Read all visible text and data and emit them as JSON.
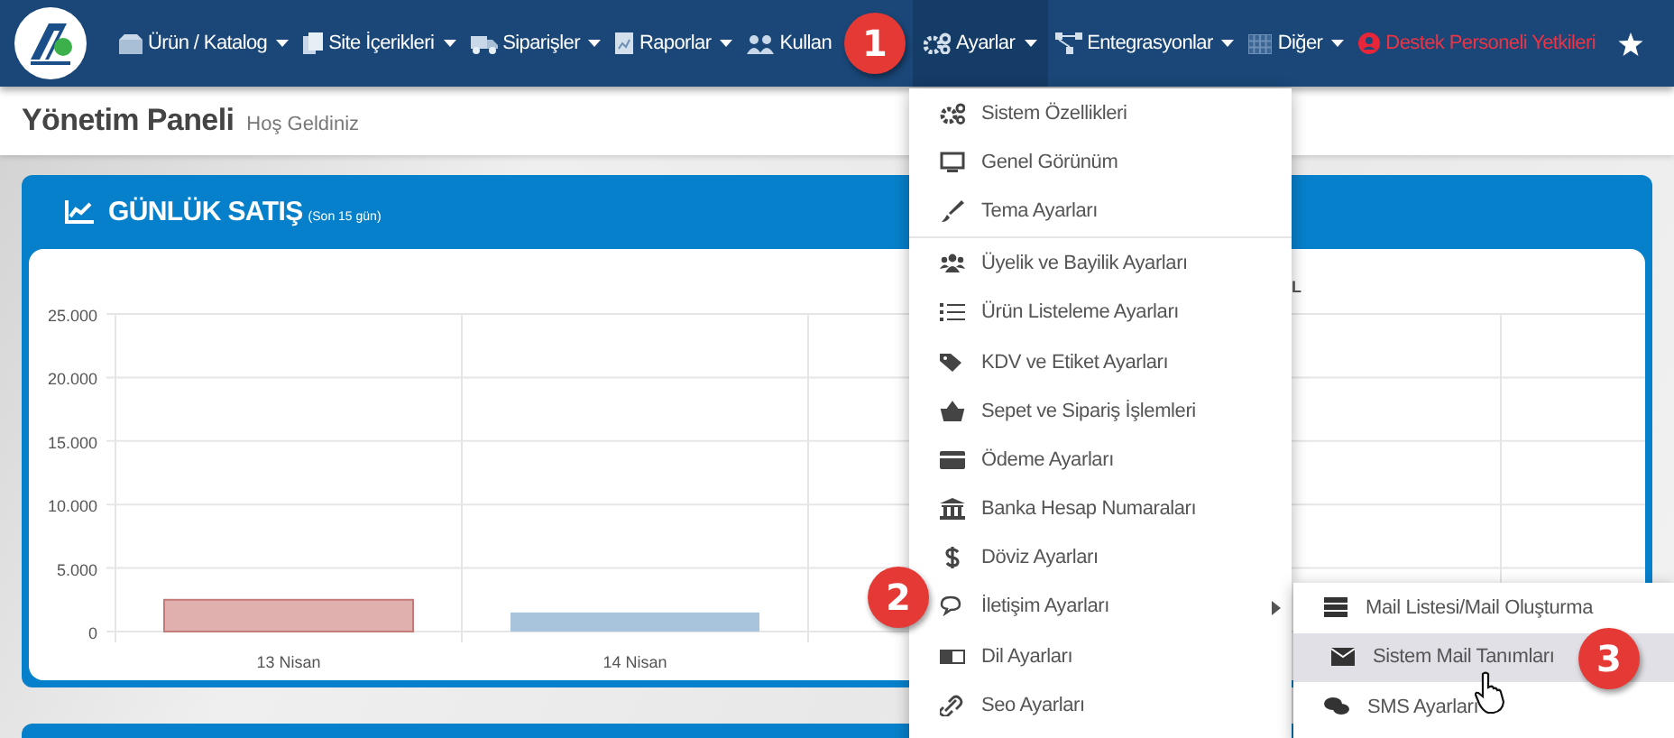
{
  "navbar": {
    "items": [
      {
        "label": "Ürün / Katalog",
        "caret": true,
        "selected": false,
        "kind": "link"
      },
      {
        "label": "Site İçerikleri",
        "caret": true,
        "selected": false,
        "kind": "link"
      },
      {
        "label": "Siparişler",
        "caret": true,
        "selected": false,
        "kind": "link"
      },
      {
        "label": "Raporlar",
        "caret": true,
        "selected": false,
        "kind": "link"
      },
      {
        "label": "Kullan",
        "caret": false,
        "selected": false,
        "kind": "link"
      },
      {
        "label": "Ayarlar",
        "caret": true,
        "selected": true,
        "kind": "link"
      },
      {
        "label": "Entegrasyonlar",
        "caret": true,
        "selected": false,
        "kind": "link"
      },
      {
        "label": "Diğer",
        "caret": true,
        "selected": false,
        "kind": "link"
      },
      {
        "label": "Destek Personeli Yetkileri",
        "caret": false,
        "selected": false,
        "kind": "alert"
      }
    ]
  },
  "page_header": {
    "title": "Yönetim Paneli",
    "subtitle": "Hoş Geldiniz"
  },
  "sales_card": {
    "title": "GÜNLÜK SATIŞ",
    "note": "(Son 15 gün)",
    "legend_fragment": "L",
    "chart_data": {
      "type": "bar",
      "grid": true,
      "categories": [
        "13 Nisan",
        "14 Nisan"
      ],
      "ylim": [
        0,
        25000
      ],
      "yticks": [
        {
          "value": 0,
          "label": "0"
        },
        {
          "value": 5000,
          "label": "5.000"
        },
        {
          "value": 10000,
          "label": "10.000"
        },
        {
          "value": 15000,
          "label": "15.000"
        },
        {
          "value": 20000,
          "label": "20.000"
        },
        {
          "value": 25000,
          "label": "25.000"
        }
      ],
      "series": [
        {
          "values": [
            2500,
            1500
          ],
          "colors": [
            "#e0b0ae",
            "#a8c4dc"
          ]
        }
      ]
    }
  },
  "settings_menu": {
    "items": [
      {
        "label": "Sistem Özellikleri",
        "divider_before": false,
        "submenu": false
      },
      {
        "label": "Genel Görünüm",
        "divider_before": false,
        "submenu": false
      },
      {
        "label": "Tema Ayarları",
        "divider_before": false,
        "submenu": false
      },
      {
        "label": "Üyelik ve Bayilik Ayarları",
        "divider_before": true,
        "submenu": false
      },
      {
        "label": "Ürün Listeleme Ayarları",
        "divider_before": false,
        "submenu": false
      },
      {
        "label": "KDV ve Etiket Ayarları",
        "divider_before": false,
        "submenu": false
      },
      {
        "label": "Sepet ve Sipariş İşlemleri",
        "divider_before": false,
        "submenu": false
      },
      {
        "label": "Ödeme Ayarları",
        "divider_before": false,
        "submenu": false
      },
      {
        "label": "Banka Hesap Numaraları",
        "divider_before": false,
        "submenu": false
      },
      {
        "label": "Döviz Ayarları",
        "divider_before": false,
        "submenu": false
      },
      {
        "label": "İletişim Ayarları",
        "divider_before": false,
        "submenu": true
      },
      {
        "label": "Dil Ayarları",
        "divider_before": false,
        "submenu": false
      },
      {
        "label": "Seo Ayarları",
        "divider_before": false,
        "submenu": false
      }
    ]
  },
  "contact_submenu": {
    "items": [
      {
        "label": "Mail Listesi/Mail Oluşturma",
        "selected": false
      },
      {
        "label": "Sistem Mail Tanımları",
        "selected": true
      },
      {
        "label": "SMS Ayarları",
        "selected": false
      }
    ]
  },
  "callouts": [
    {
      "text": "1"
    },
    {
      "text": "2"
    },
    {
      "text": "3"
    }
  ]
}
